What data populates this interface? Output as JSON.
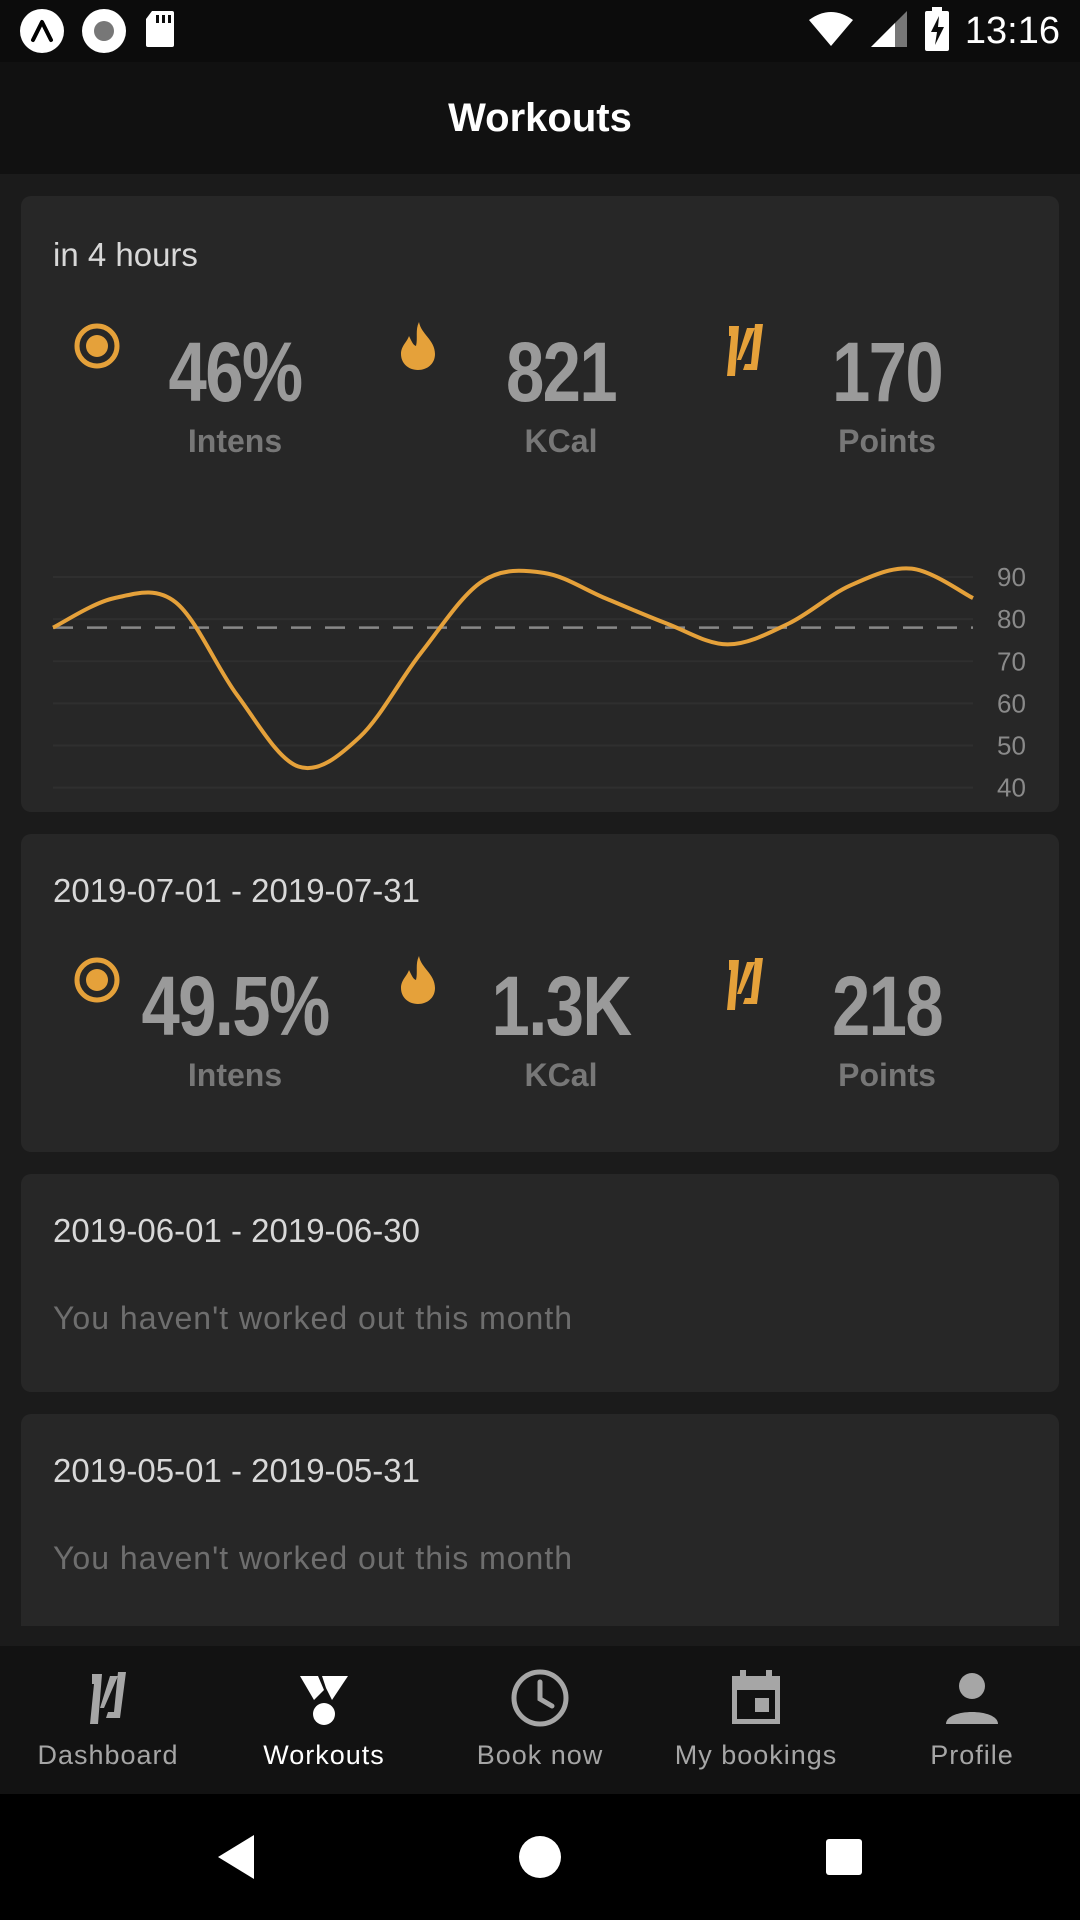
{
  "status_bar": {
    "time": "13:16"
  },
  "header": {
    "title": "Workouts"
  },
  "colors": {
    "accent": "#e5a13a",
    "card": "#272727",
    "bg": "#1b1b1b"
  },
  "cards": [
    {
      "label": "in 4 hours",
      "stats": [
        {
          "value": "46%",
          "label": "Intens",
          "icon": "target-icon"
        },
        {
          "value": "821",
          "label": "KCal",
          "icon": "flame-icon"
        },
        {
          "value": "170",
          "label": "Points",
          "icon": "brand-logo-icon"
        }
      ]
    },
    {
      "label": "2019-07-01 - 2019-07-31",
      "stats": [
        {
          "value": "49.5%",
          "label": "Intens",
          "icon": "target-icon"
        },
        {
          "value": "1.3K",
          "label": "KCal",
          "icon": "flame-icon"
        },
        {
          "value": "218",
          "label": "Points",
          "icon": "brand-logo-icon"
        }
      ]
    },
    {
      "label": "2019-06-01 - 2019-06-30",
      "message": "You haven't worked out this month"
    },
    {
      "label": "2019-05-01 - 2019-05-31",
      "message": "You haven't worked out this month"
    }
  ],
  "chart_data": {
    "type": "line",
    "y_ticks": [
      90,
      80,
      70,
      60,
      50,
      40
    ],
    "ylim": [
      38,
      95
    ],
    "reference_line": 78,
    "grid": true,
    "series": [
      {
        "values": [
          78,
          85,
          84,
          62,
          45,
          52,
          72,
          89,
          91,
          85,
          79,
          74,
          79,
          88,
          92,
          85
        ]
      }
    ]
  },
  "nav": [
    {
      "label": "Dashboard",
      "icon": "brand-logo-icon",
      "active": false
    },
    {
      "label": "Workouts",
      "icon": "medal-icon",
      "active": true
    },
    {
      "label": "Book now",
      "icon": "clock-icon",
      "active": false
    },
    {
      "label": "My bookings",
      "icon": "calendar-icon",
      "active": false
    },
    {
      "label": "Profile",
      "icon": "person-icon",
      "active": false
    }
  ]
}
